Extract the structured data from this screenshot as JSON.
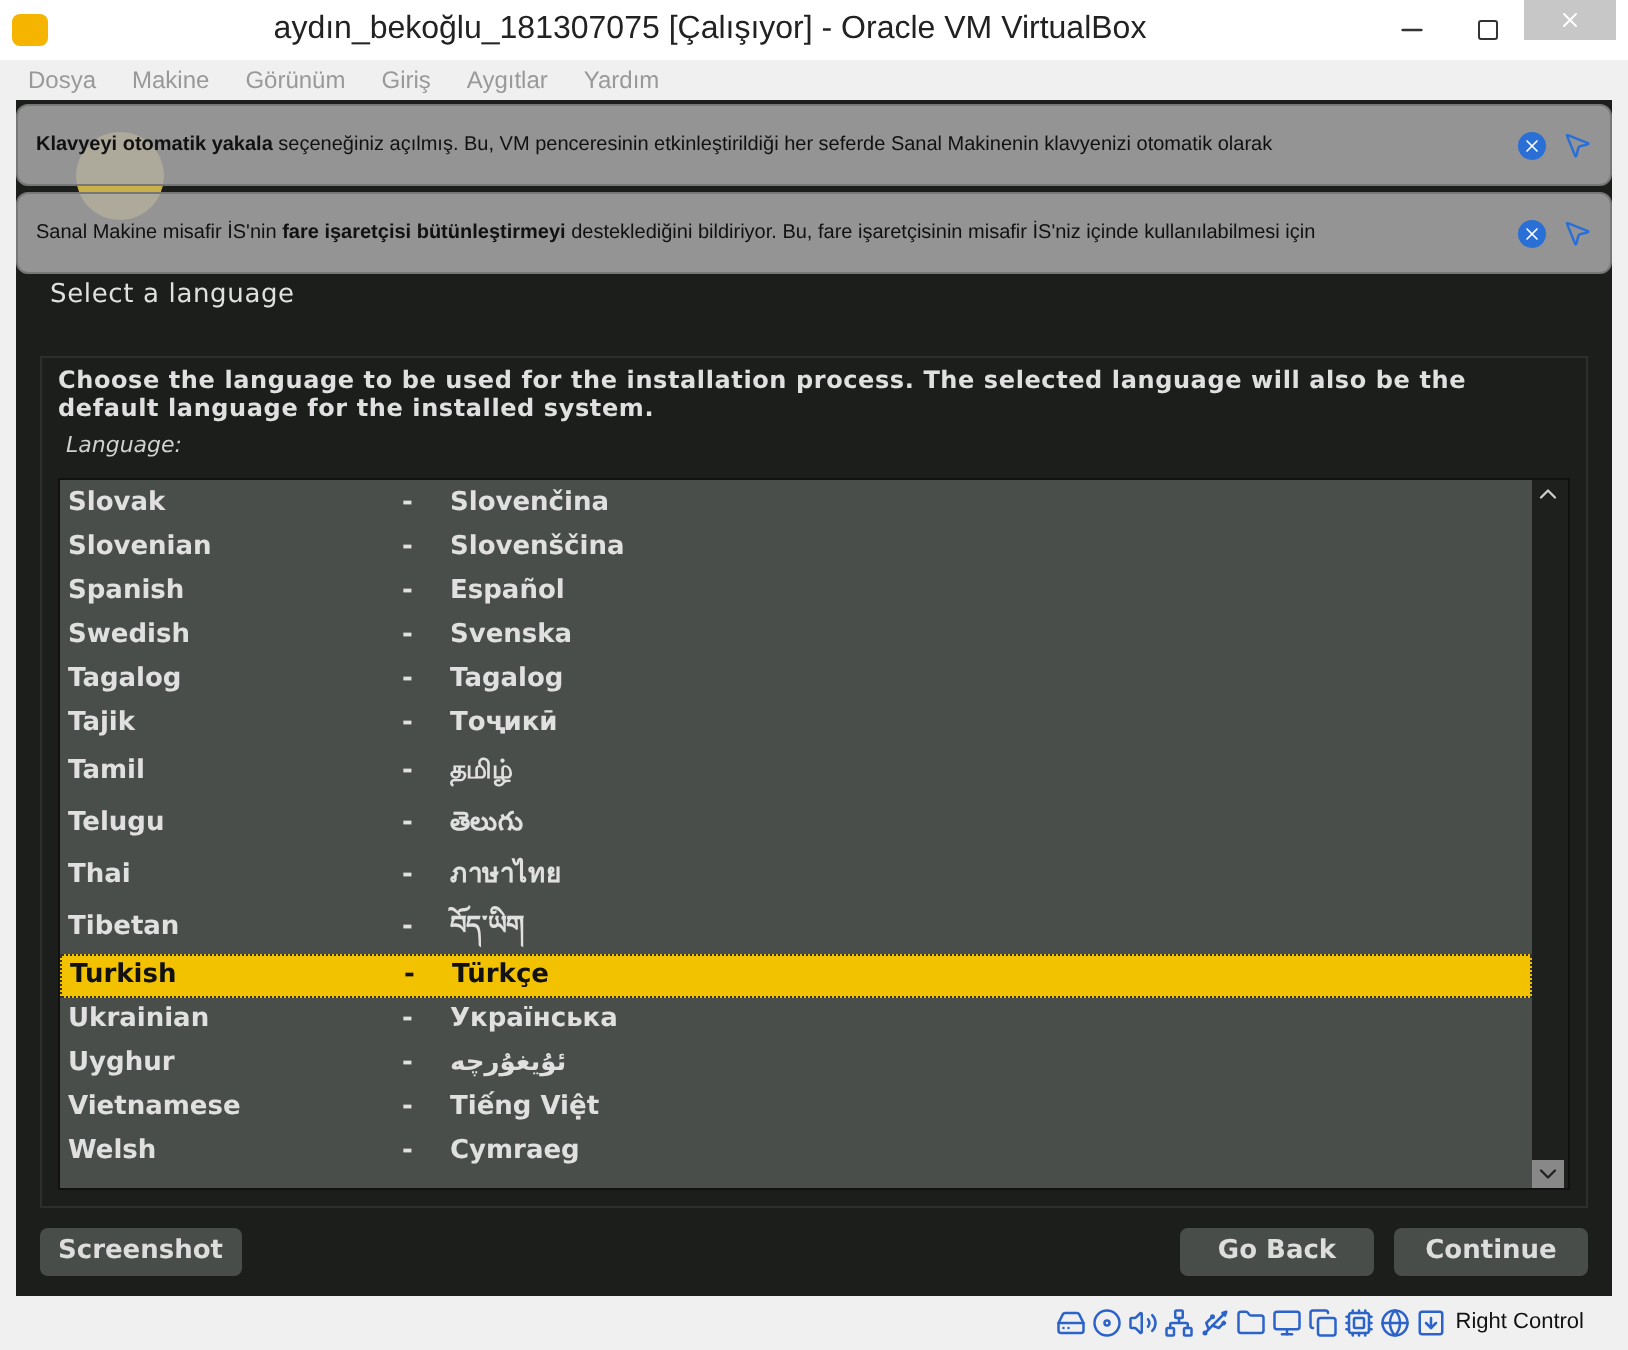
{
  "window": {
    "title": "aydın_bekoğlu_181307075 [Çalışıyor] - Oracle VM VirtualBox"
  },
  "menu": [
    "Dosya",
    "Makine",
    "Görünüm",
    "Giriş",
    "Aygıtlar",
    "Yardım"
  ],
  "notifications": [
    {
      "text": "**Klavyeyi otomatik yakala** seçeneğiniz açılmış. Bu, VM penceresinin etkinleştirildiği her seferde Sanal Makinenin klavyenizi otomatik olarak"
    },
    {
      "text": "Sanal Makine misafir İS'nin **fare işaretçisi bütünleştirmeyi** desteklediğini bildiriyor. Bu, fare işaretçisinin misafir İS'niz içinde kullanılabilmesi için"
    }
  ],
  "installer": {
    "heading": "Select a language",
    "description": "Choose the language to be used for the installation process. The selected language will also be the default language for the installed system.",
    "list_label": "Language:",
    "languages": [
      {
        "name": "Slovak",
        "sep": "-",
        "native": "Slovenčina",
        "selected": false
      },
      {
        "name": "Slovenian",
        "sep": "-",
        "native": "Slovenščina",
        "selected": false
      },
      {
        "name": "Spanish",
        "sep": "-",
        "native": "Español",
        "selected": false
      },
      {
        "name": "Swedish",
        "sep": "-",
        "native": "Svenska",
        "selected": false
      },
      {
        "name": "Tagalog",
        "sep": "-",
        "native": "Tagalog",
        "selected": false
      },
      {
        "name": "Tajik",
        "sep": "-",
        "native": "Тоҷикӣ",
        "selected": false
      },
      {
        "name": "Tamil",
        "sep": "-",
        "native": "தமிழ்",
        "selected": false
      },
      {
        "name": "Telugu",
        "sep": "-",
        "native": "తెలుగు",
        "selected": false
      },
      {
        "name": "Thai",
        "sep": "-",
        "native": "ภาษาไทย",
        "selected": false
      },
      {
        "name": "Tibetan",
        "sep": "-",
        "native": "བོད་ཡིག",
        "selected": false
      },
      {
        "name": "Turkish",
        "sep": "-",
        "native": "Türkçe",
        "selected": true
      },
      {
        "name": "Ukrainian",
        "sep": "-",
        "native": "Українська",
        "selected": false
      },
      {
        "name": "Uyghur",
        "sep": "-",
        "native": "ئۇيغۇرچە",
        "selected": false
      },
      {
        "name": "Vietnamese",
        "sep": "-",
        "native": "Tiếng Việt",
        "selected": false
      },
      {
        "name": "Welsh",
        "sep": "-",
        "native": "Cymraeg",
        "selected": false
      }
    ],
    "buttons": {
      "left": "Screenshot",
      "back": "Go Back",
      "next": "Continue"
    }
  },
  "status_bar": {
    "host_key": "Right Control"
  }
}
